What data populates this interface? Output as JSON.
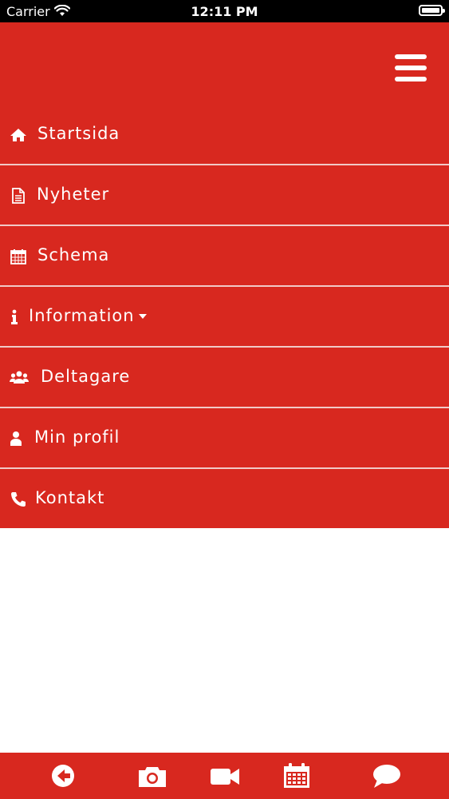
{
  "status_bar": {
    "carrier": "Carrier",
    "time": "12:11 PM"
  },
  "header": {
    "menu_icon": "hamburger-icon"
  },
  "menu": {
    "items": [
      {
        "label": "Startsida",
        "icon": "home-icon"
      },
      {
        "label": "Nyheter",
        "icon": "document-icon"
      },
      {
        "label": "Schema",
        "icon": "calendar-icon"
      },
      {
        "label": "Information",
        "icon": "info-icon",
        "has_dropdown": true
      },
      {
        "label": "Deltagare",
        "icon": "users-icon"
      },
      {
        "label": "Min profil",
        "icon": "user-icon"
      },
      {
        "label": "Kontakt",
        "icon": "phone-icon"
      }
    ]
  },
  "bottom_bar": {
    "tabs": [
      {
        "icon": "back-arrow-icon"
      },
      {
        "icon": "camera-icon"
      },
      {
        "icon": "video-camera-icon"
      },
      {
        "icon": "calendar-icon"
      },
      {
        "icon": "chat-bubble-icon"
      }
    ]
  },
  "colors": {
    "brand_red": "#d8281f",
    "divider": "#f1c9c6",
    "text": "#ffffff"
  }
}
